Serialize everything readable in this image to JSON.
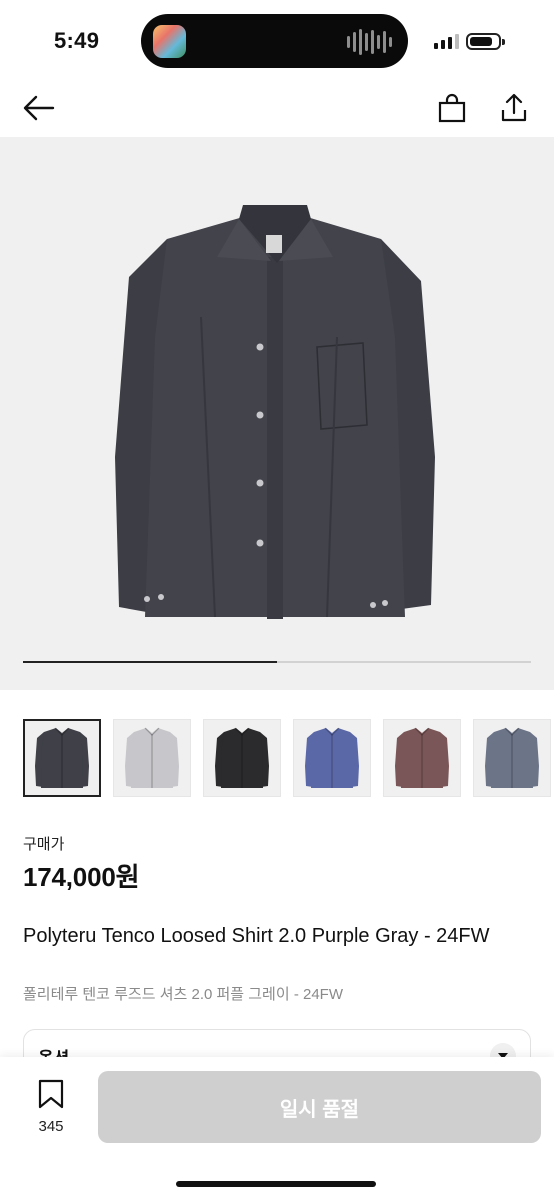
{
  "status_bar": {
    "time": "5:49",
    "battery_level": 0.85,
    "icons": [
      "app-thumbnail-icon",
      "audio-waveform-icon",
      "cellular-signal-icon",
      "battery-icon"
    ]
  },
  "header": {
    "icons": [
      "back-arrow-icon",
      "shopping-bag-icon",
      "share-icon"
    ]
  },
  "gallery": {
    "progress": 0.5,
    "thumbnails": [
      {
        "name": "purple-gray",
        "color": "#3f4048",
        "selected": true
      },
      {
        "name": "light-gray",
        "color": "#c7c7cb",
        "selected": false
      },
      {
        "name": "black",
        "color": "#2b2b2d",
        "selected": false
      },
      {
        "name": "blue",
        "color": "#5b68a8",
        "selected": false
      },
      {
        "name": "brown",
        "color": "#7b5658",
        "selected": false
      },
      {
        "name": "blue-gray",
        "color": "#6c7488",
        "selected": false
      }
    ]
  },
  "product": {
    "price_label": "구매가",
    "price": "174,000원",
    "title": "Polyteru Tenco Loosed Shirt 2.0 Purple Gray - 24FW",
    "subtitle": "폴리테루 텐코 루즈드 셔츠 2.0 퍼플 그레이 - 24FW",
    "option_label": "옵션"
  },
  "bottom_bar": {
    "bookmark_count": "345",
    "button_label": "일시 품절"
  },
  "colors": {
    "shirt": "#3f4048",
    "disabled_button": "#cfcfcf",
    "gallery_bg": "#f0f0f0"
  }
}
